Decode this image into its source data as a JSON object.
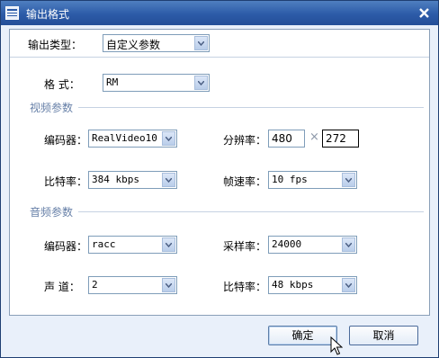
{
  "window": {
    "title": "输出格式",
    "close_icon": "close-icon"
  },
  "output_type": {
    "label": "输出类型：",
    "value": "自定义参数"
  },
  "format": {
    "label": "格  式：",
    "value": "RM"
  },
  "video": {
    "section_title": "视频参数",
    "encoder": {
      "label": "编码器：",
      "value": "RealVideo10"
    },
    "resolution": {
      "label": "分辨率：",
      "width": "480",
      "separator": "×",
      "height": "272"
    },
    "bitrate": {
      "label": "比特率：",
      "value": "384 kbps"
    },
    "framerate": {
      "label": "帧速率：",
      "value": "10 fps"
    }
  },
  "audio": {
    "section_title": "音频参数",
    "encoder": {
      "label": "编码器：",
      "value": "racc"
    },
    "samplerate": {
      "label": "采样率：",
      "value": "24000"
    },
    "channels": {
      "label": "声  道：",
      "value": "2"
    },
    "bitrate": {
      "label": "比特率：",
      "value": "48 kbps"
    }
  },
  "buttons": {
    "ok": "确定",
    "cancel": "取消"
  },
  "colors": {
    "titlebar": "#2c5ba8",
    "section": "#6780a8",
    "dialog_bg": "#e9f0fa"
  }
}
